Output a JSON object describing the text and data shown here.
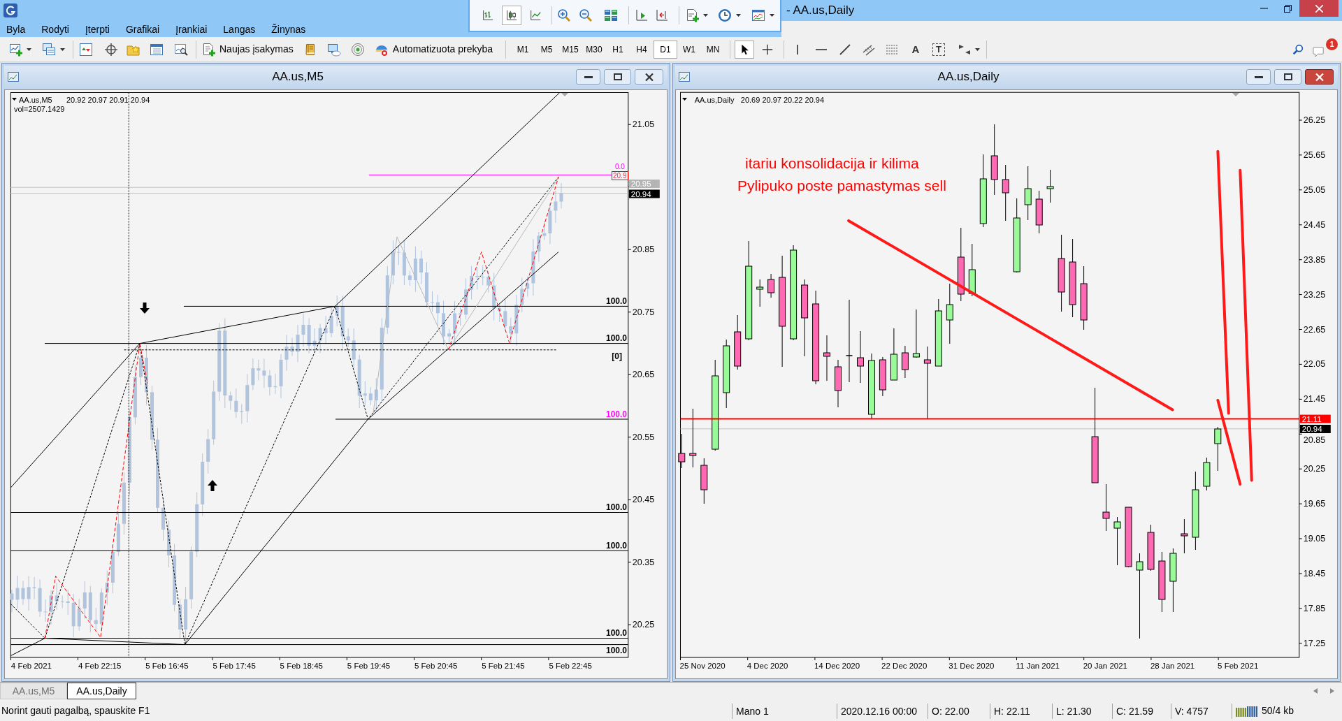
{
  "window": {
    "title": "- AA.us,Daily"
  },
  "menu": [
    "Byla",
    "Rodyti",
    "Įterpti",
    "Grafikai",
    "Įrankiai",
    "Langas",
    "Žinynas"
  ],
  "floating_toolbar": {
    "chart_types": [
      {
        "selected": false
      },
      {
        "selected": true
      },
      {
        "selected": false
      }
    ]
  },
  "toolbar": {
    "new_order": "Naujas įsakymas",
    "auto_trading": "Automatizuota prekyba",
    "timeframes": [
      {
        "label": "M1",
        "selected": false
      },
      {
        "label": "M5",
        "selected": false
      },
      {
        "label": "M15",
        "selected": false
      },
      {
        "label": "M30",
        "selected": false
      },
      {
        "label": "H1",
        "selected": false
      },
      {
        "label": "H4",
        "selected": false
      },
      {
        "label": "D1",
        "selected": true
      },
      {
        "label": "W1",
        "selected": false
      },
      {
        "label": "MN",
        "selected": false
      }
    ],
    "pointer_tools": [
      {
        "selected": true
      },
      {
        "selected": false
      }
    ],
    "text_tools": [
      "A",
      "T"
    ],
    "notifications": "1"
  },
  "charts": [
    {
      "title": "AA.us,M5",
      "active": false,
      "symbol": "AA.us,M5",
      "prices": "20.92 20.97 20.91 20.94",
      "indicator": "vol=2507.1429",
      "price_labels": [
        {
          "text": "21.05",
          "kind": "tick"
        },
        {
          "text": "20.95",
          "kind": "line"
        },
        {
          "text": "20.85",
          "kind": "tick"
        },
        {
          "text": "20.75",
          "kind": "tick"
        },
        {
          "text": "20.65",
          "kind": "tick"
        },
        {
          "text": "20.55",
          "kind": "tick"
        },
        {
          "text": "20.45",
          "kind": "tick"
        },
        {
          "text": "20.35",
          "kind": "tick"
        },
        {
          "text": "20.25",
          "kind": "tick"
        }
      ],
      "high_label": {
        "price": "20.9",
        "level": "0.0"
      },
      "bid_label": "20.94",
      "level_labels": [
        {
          "text": "100.0",
          "color": "#000000"
        },
        {
          "text": "100.0",
          "color": "#000000"
        },
        {
          "text": "[0]",
          "color": "#000000"
        },
        {
          "text": "100.0",
          "color": "#ff00ff"
        },
        {
          "text": "100.0",
          "color": "#000000"
        },
        {
          "text": "100.0",
          "color": "#000000"
        },
        {
          "text": "100.0",
          "color": "#000000"
        },
        {
          "text": "100.0",
          "color": "#000000"
        }
      ],
      "time_labels": [
        "4 Feb 2021",
        "4 Feb 22:15",
        "5 Feb 16:45",
        "5 Feb 17:45",
        "5 Feb 18:45",
        "5 Feb 19:45",
        "5 Feb 20:45",
        "5 Feb 21:45",
        "5 Feb 22:45"
      ]
    },
    {
      "title": "AA.us,Daily",
      "active": true,
      "symbol": "AA.us,Daily",
      "prices": "20.69 20.97 20.22 20.94",
      "annotations": [
        "itariu konsolidacija ir kilima",
        "Pylipuko poste pamastymas sell"
      ],
      "price_labels": [
        {
          "text": "26.25",
          "kind": "tick"
        },
        {
          "text": "25.65",
          "kind": "tick"
        },
        {
          "text": "25.05",
          "kind": "tick"
        },
        {
          "text": "24.45",
          "kind": "tick"
        },
        {
          "text": "23.85",
          "kind": "tick"
        },
        {
          "text": "23.25",
          "kind": "tick"
        },
        {
          "text": "22.65",
          "kind": "tick"
        },
        {
          "text": "22.05",
          "kind": "tick"
        },
        {
          "text": "21.45",
          "kind": "tick"
        },
        {
          "text": "20.85",
          "kind": "tick"
        },
        {
          "text": "20.25",
          "kind": "tick"
        },
        {
          "text": "19.65",
          "kind": "tick"
        },
        {
          "text": "19.05",
          "kind": "tick"
        },
        {
          "text": "18.45",
          "kind": "tick"
        },
        {
          "text": "17.85",
          "kind": "tick"
        },
        {
          "text": "17.25",
          "kind": "tick"
        }
      ],
      "line_label": "21.11",
      "bid_label": "20.94",
      "time_labels": [
        "25 Nov 2020",
        "4 Dec 2020",
        "14 Dec 2020",
        "22 Dec 2020",
        "31 Dec 2020",
        "11 Jan 2021",
        "20 Jan 2021",
        "28 Jan 2021",
        "5 Feb 2021"
      ]
    }
  ],
  "tabs": [
    {
      "label": "AA.us,M5",
      "selected": false
    },
    {
      "label": "AA.us,Daily",
      "selected": true
    }
  ],
  "status_bar": {
    "help": "Norint gauti pagalbą, spauskite F1",
    "fields": [
      "Mano 1",
      "2020.12.16 00:00",
      "O: 22.00",
      "H: 22.11",
      "L: 21.30",
      "C: 21.59",
      "V: 4757"
    ],
    "traffic": "50/4 kb"
  }
}
